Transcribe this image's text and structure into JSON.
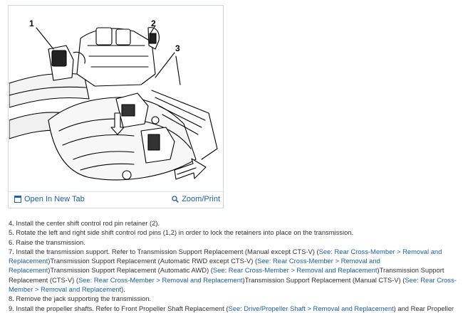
{
  "figure": {
    "callouts": [
      "1",
      "2",
      "3"
    ],
    "open_link": "Open In New Tab",
    "zoom_link": "Zoom/Print"
  },
  "steps": [
    {
      "parts": [
        {
          "t": " 4. Install the center shift control rod pin retainer (2)."
        }
      ]
    },
    {
      "parts": [
        {
          "t": " 5. Rotate the left and right side shift control rod pins (1,2) in order to lock the retainers into place on the transmission."
        }
      ]
    },
    {
      "parts": [
        {
          "t": " 6. Raise the transmission."
        }
      ]
    },
    {
      "parts": [
        {
          "t": " 7. Install the transmission support. Refer to Transmission Support Replacement (Manual except CTS-V) ("
        },
        {
          "t": "See: Rear Cross-Member > Removal and Replacement",
          "link": true
        },
        {
          "t": ")Transmission Support Replacement (Automatic RWD except CTS-V) ("
        },
        {
          "t": "See: Rear Cross-Member > Removal and Replacement",
          "link": true
        },
        {
          "t": ")Transmission Support Replacement (Automatic AWD) ("
        },
        {
          "t": "See: Rear Cross-Member > Removal and Replacement",
          "link": true
        },
        {
          "t": ")Transmission Support Replacement (CTS-V) ("
        },
        {
          "t": "See: Rear Cross-Member > Removal and Replacement",
          "link": true
        },
        {
          "t": ")Transmission Support Replacement (Manual CTS-V) ("
        },
        {
          "t": "See: Rear Cross-Member > Removal and Replacement",
          "link": true
        },
        {
          "t": ")."
        }
      ]
    },
    {
      "parts": [
        {
          "t": " 8. Remove the jack supporting the transmission."
        }
      ]
    },
    {
      "parts": [
        {
          "t": " 9. Install the propeller shafts. Refer to Front Propeller Shaft Replacement ("
        },
        {
          "t": "See: Drive/Propeller Shaft > Removal and Replacement",
          "link": true
        },
        {
          "t": ") and Rear Propeller"
        }
      ]
    }
  ]
}
